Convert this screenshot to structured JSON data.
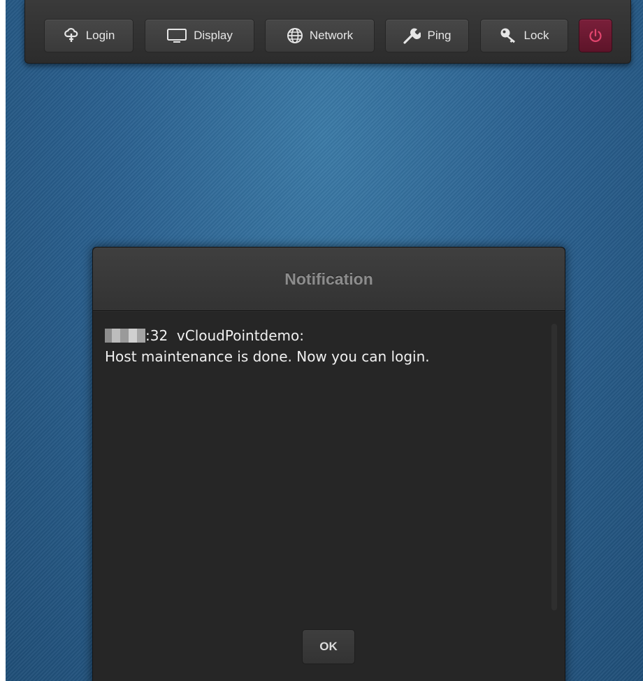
{
  "toolbar": {
    "buttons": [
      {
        "label": "Login",
        "icon": "cloud-login-icon"
      },
      {
        "label": "Display",
        "icon": "monitor-icon"
      },
      {
        "label": "Network",
        "icon": "globe-icon"
      },
      {
        "label": "Ping",
        "icon": "wrench-icon"
      },
      {
        "label": "Lock",
        "icon": "key-icon"
      },
      {
        "label": "",
        "icon": "power-icon"
      }
    ]
  },
  "dialog": {
    "title": "Notification",
    "message_time": ":32",
    "message_sender": "vCloudPointdemo:",
    "message_text": "Host maintenance is done. Now you can login.",
    "ok_label": "OK"
  },
  "colors": {
    "desktop_bg": "#2a5f88",
    "toolbar_bg": "#333333",
    "power_button": "#6b1a32",
    "dialog_bg": "#262626"
  }
}
